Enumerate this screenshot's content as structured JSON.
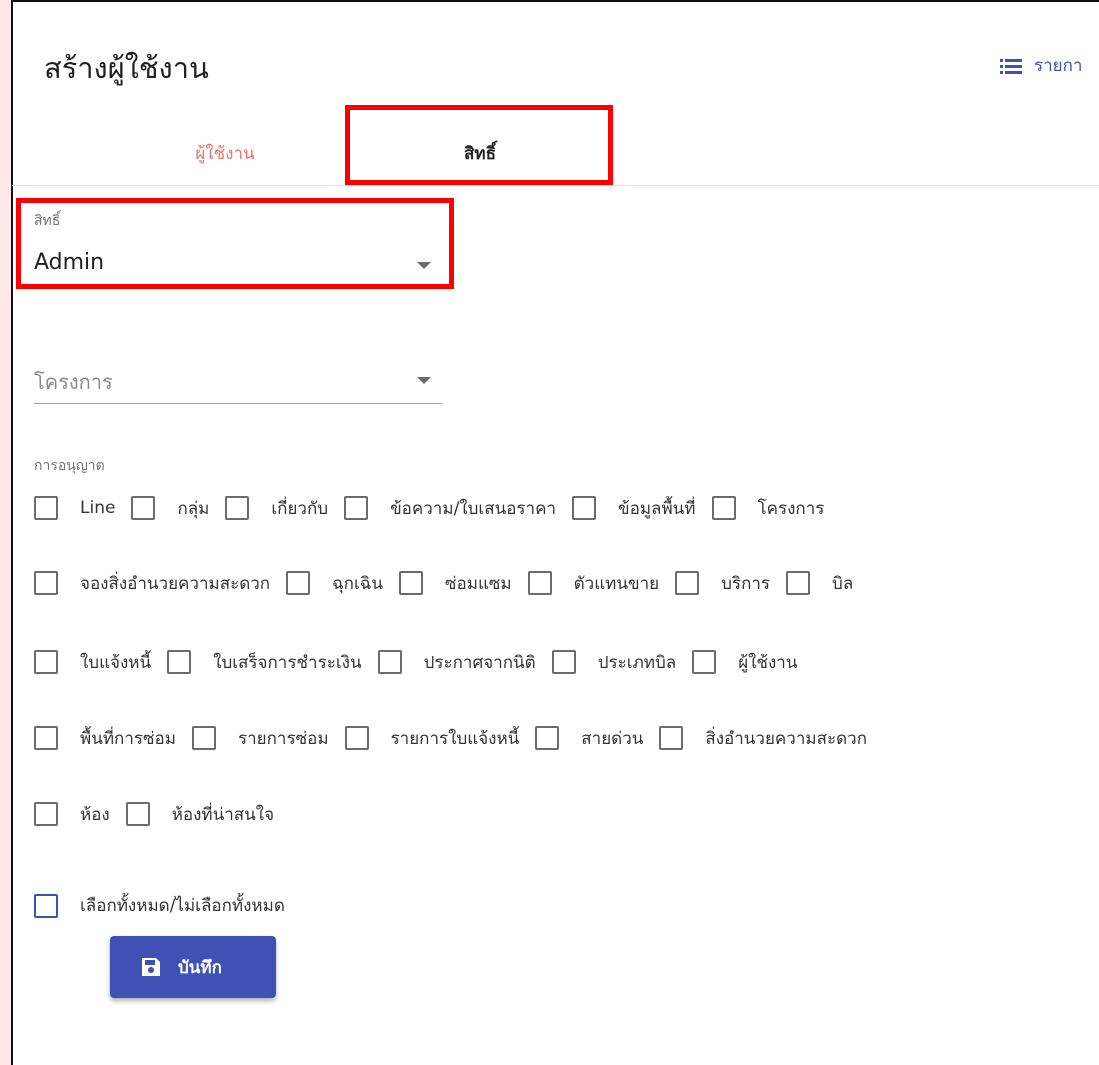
{
  "header": {
    "title": "สร้างผู้ใช้งาน",
    "list_link": "รายกา",
    "list_icon": "list-icon"
  },
  "tabs": [
    {
      "label": "ผู้ใช้งาน",
      "active": false
    },
    {
      "label": "สิทธิ์",
      "active": true
    }
  ],
  "role": {
    "label": "สิทธิ์",
    "value": "Admin"
  },
  "project": {
    "placeholder": "โครงการ"
  },
  "permissions": {
    "label": "การอนุญาต",
    "rows": [
      [
        "Line",
        "กลุ่ม",
        "เกี่ยวกับ",
        "ข้อความ/ใบเสนอราคา",
        "ข้อมูลพื้นที่",
        "โครงการ"
      ],
      [
        "จองสิ่งอำนวยความสะดวก",
        "ฉุกเฉิน",
        "ซ่อมแซม",
        "ตัวแทนขาย",
        "บริการ",
        "บิล"
      ],
      [
        "ใบแจ้งหนี้",
        "ใบเสร็จการชำระเงิน",
        "ประกาศจากนิติ",
        "ประเภทบิล",
        "ผู้ใช้งาน"
      ],
      [
        "พื้นที่การซ่อม",
        "รายการซ่อม",
        "รายการใบแจ้งหนี้",
        "สายด่วน",
        "สิ่งอำนวยความสะดวก"
      ],
      [
        "ห้อง",
        "ห้องที่น่าสนใจ"
      ]
    ],
    "select_all": "เลือกทั้งหมด/ไม่เลือกทั้งหมด"
  },
  "save_button": {
    "label": "บันทึก",
    "icon": "save-icon"
  },
  "colors": {
    "primary": "#3f51b5",
    "tab_inactive": "#e57373",
    "highlight": "#ff0000"
  }
}
